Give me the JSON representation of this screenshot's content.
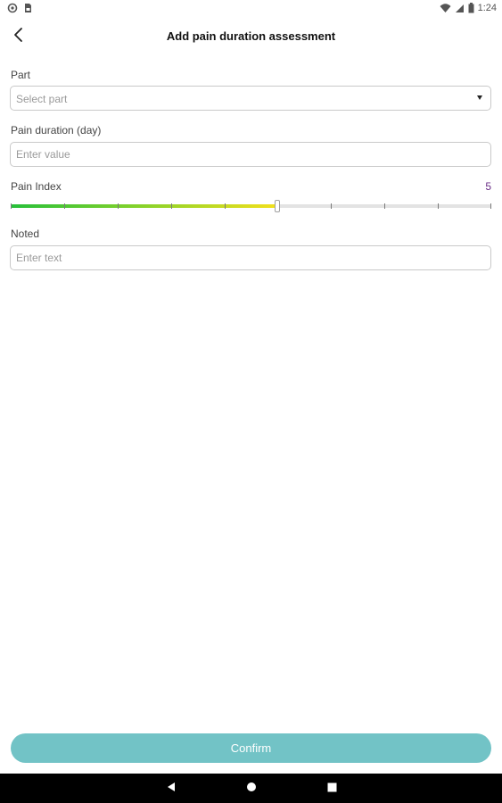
{
  "status_bar": {
    "time": "1:24",
    "left_icons": [
      "settings-circle-icon",
      "sim-card-icon"
    ],
    "right_icons": [
      "wifi-icon",
      "cellular-signal-icon",
      "battery-icon"
    ]
  },
  "header": {
    "back_icon": "chevron-left-icon",
    "title": "Add pain duration assessment"
  },
  "form": {
    "part": {
      "label": "Part",
      "placeholder": "Select part",
      "dropdown_icon": "caret-down-icon"
    },
    "duration": {
      "label": "Pain duration (day)",
      "placeholder": "Enter value",
      "value": ""
    },
    "pain_index": {
      "label": "Pain Index",
      "value": "5",
      "value_number": 5,
      "min": 0,
      "max": 9,
      "gradient_start_color": "#27bf3a",
      "gradient_end_color": "#f2e01c",
      "value_color": "#6a2d86"
    },
    "noted": {
      "label": "Noted",
      "placeholder": "Enter text",
      "value": ""
    }
  },
  "footer": {
    "confirm_label": "Confirm",
    "confirm_color": "#72c3c6"
  },
  "nav_bar": {
    "buttons": [
      "back-triangle-icon",
      "home-circle-icon",
      "recents-square-icon"
    ]
  }
}
